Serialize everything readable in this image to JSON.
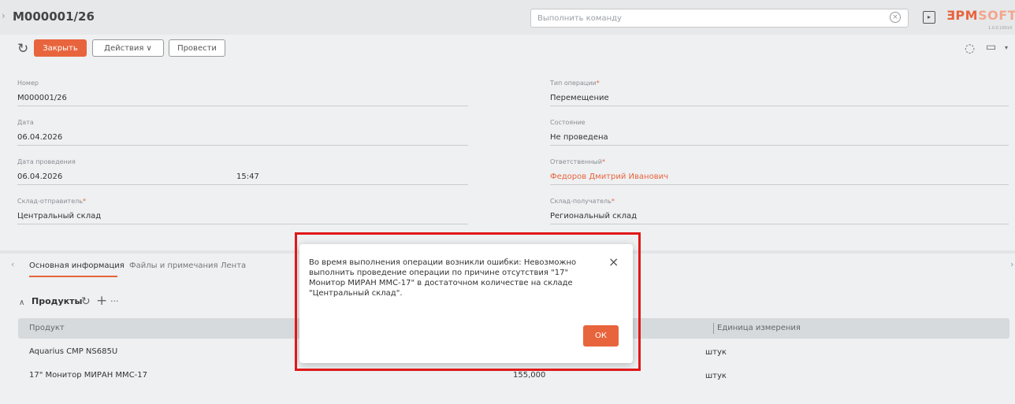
{
  "header": {
    "title": "M000001/26",
    "command_placeholder": "Выполнить команду",
    "logo_part1": "ƎPM",
    "logo_part2": "SOFT",
    "version": "1.0.0.10014"
  },
  "toolbar": {
    "close_label": "Закрыть",
    "actions_label": "Действия ∨",
    "post_label": "Провести"
  },
  "form": {
    "number": {
      "label": "Номер",
      "value": "M000001/26"
    },
    "operation_type": {
      "label": "Тип операции",
      "value": "Перемещение"
    },
    "date": {
      "label": "Дата",
      "value": "06.04.2026"
    },
    "state": {
      "label": "Состояние",
      "value": "Не проведена"
    },
    "posting_date": {
      "label": "Дата проведения",
      "value": "06.04.2026",
      "time": "15:47"
    },
    "responsible": {
      "label": "Ответственный",
      "value": "Федоров Дмитрий Иванович"
    },
    "sender_warehouse": {
      "label": "Склад-отправитель",
      "value": "Центральный склад"
    },
    "receiver_warehouse": {
      "label": "Склад-получатель",
      "value": "Региональный склад"
    }
  },
  "tabs": [
    {
      "label": "Основная информация"
    },
    {
      "label": "Файлы и примечания"
    },
    {
      "label": "Лента"
    }
  ],
  "products": {
    "title": "Продукты",
    "columns": [
      "Продукт",
      "Единица измерения"
    ],
    "rows": [
      {
        "product": "Aquarius CMP NS685U",
        "quantity": "",
        "unit": "штук"
      },
      {
        "product": "17\" Монитор МИРАН ММС-17",
        "quantity": "155,000",
        "unit": "штук"
      }
    ]
  },
  "dialog": {
    "message": "Во время выполнения операции возникли ошибки: Невозможно выполнить проведение операции по причине отсутствия \"17\" Монитор МИРАН ММС-17\" в достаточном количестве на складе \"Центральный склад\".",
    "ok_label": "ОК"
  },
  "colors": {
    "accent": "#e8643c",
    "highlight": "#e01818"
  }
}
